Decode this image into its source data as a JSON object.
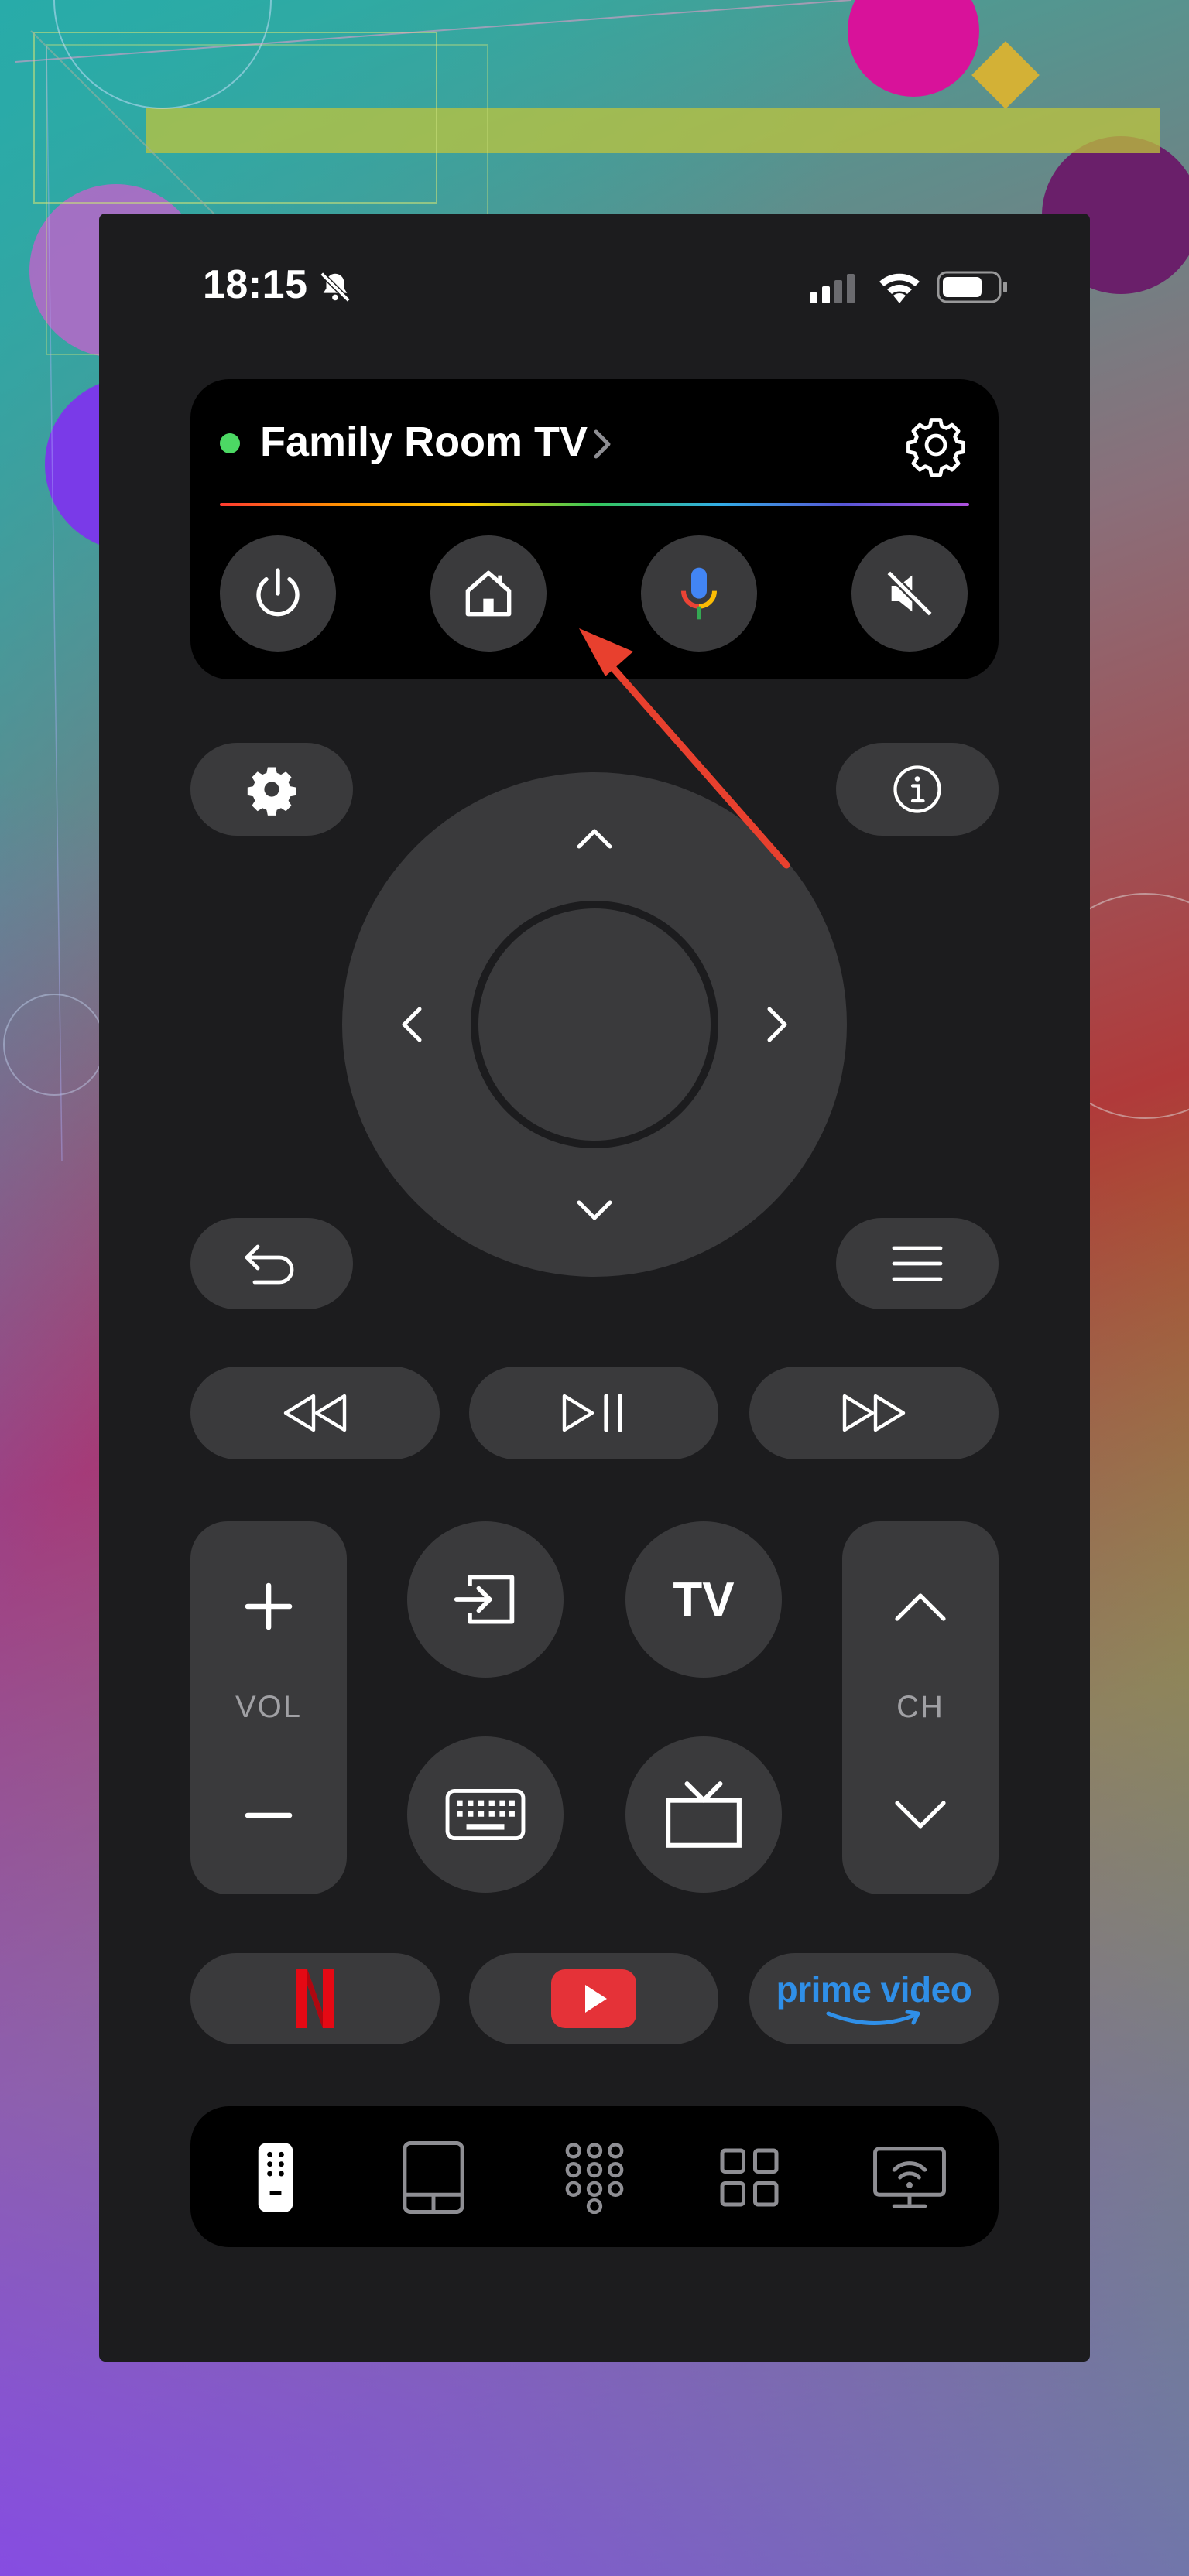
{
  "status_bar": {
    "time": "18:15"
  },
  "device": {
    "name": "Family Room TV",
    "connected": true,
    "status_color": "#4cd964"
  },
  "labels": {
    "volume": "VOL",
    "channel": "CH",
    "tv": "TV"
  },
  "apps": {
    "netflix": "N",
    "prime": "prime video"
  },
  "colors": {
    "accent_prime": "#2f8fe8",
    "netflix_red": "#e50914",
    "youtube_red": "#e53238",
    "annotation": "#e8402e"
  },
  "icons": [
    "power-icon",
    "home-icon",
    "microphone-icon",
    "mute-icon",
    "gear-icon",
    "info-icon",
    "back-icon",
    "menu-icon",
    "rewind-icon",
    "play-pause-icon",
    "fast-forward-icon",
    "input-icon",
    "keyboard-icon",
    "live-tv-icon",
    "remote-tab-icon",
    "touchpad-tab-icon",
    "numpad-tab-icon",
    "apps-tab-icon",
    "cast-tab-icon"
  ]
}
